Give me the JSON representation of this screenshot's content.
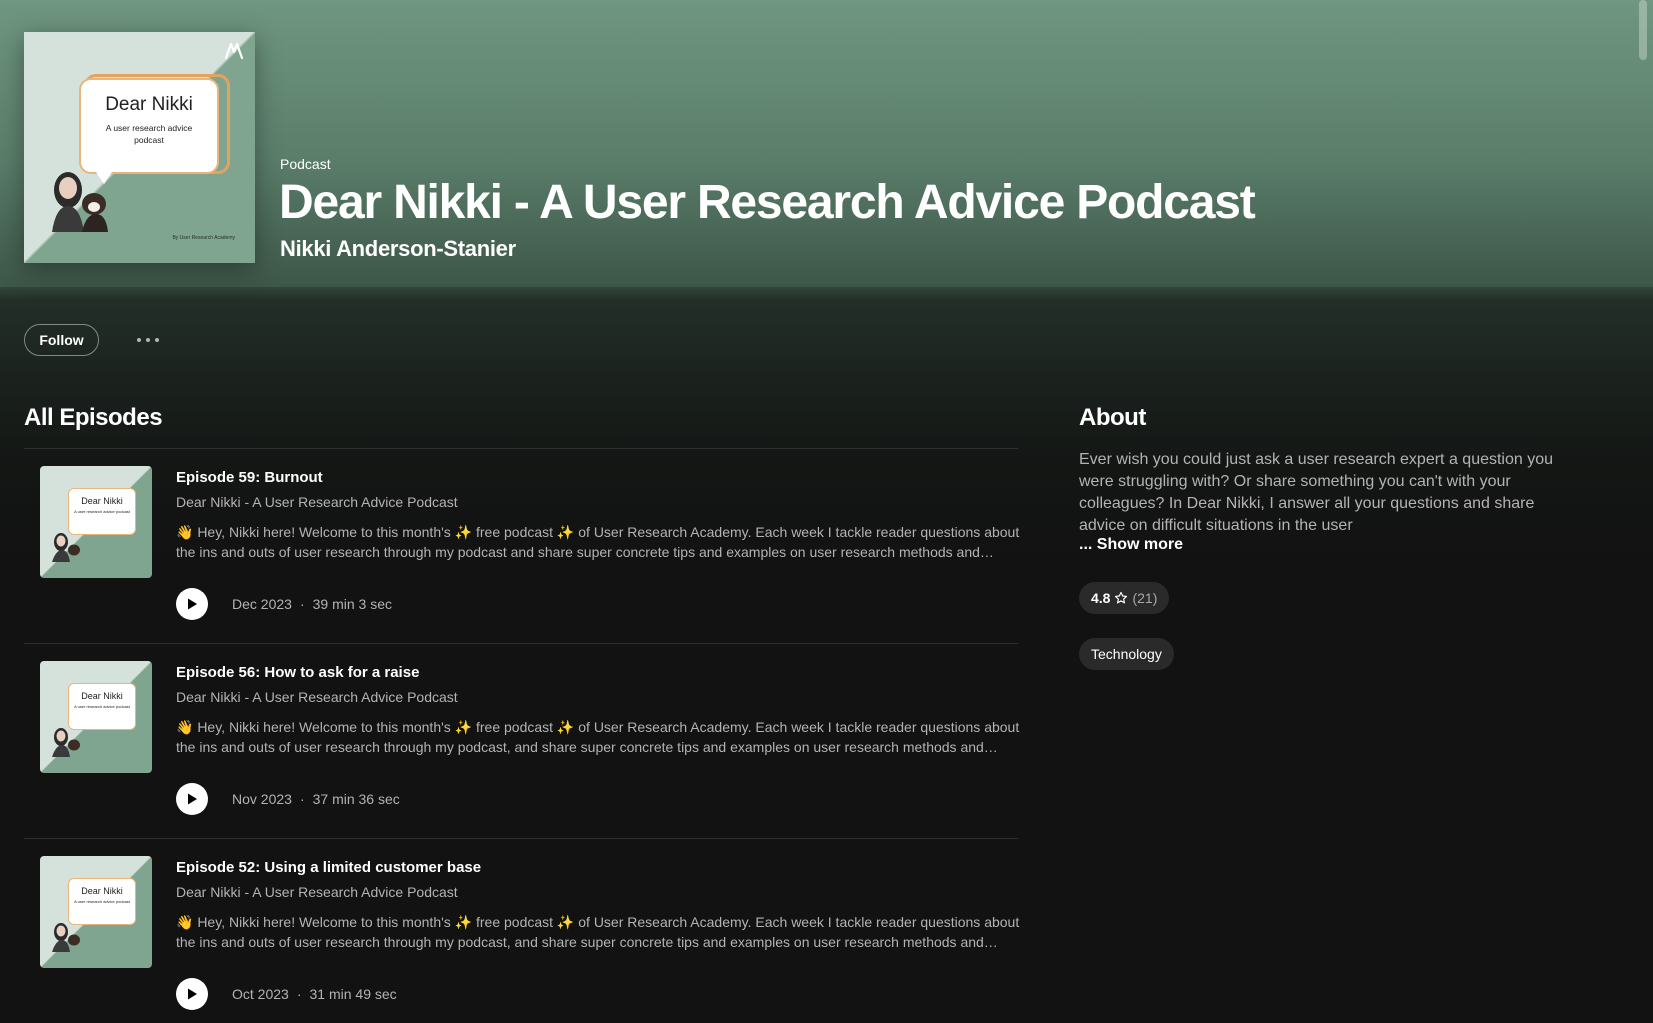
{
  "header": {
    "type_label": "Podcast",
    "title": "Dear Nikki - A User Research Advice Podcast",
    "author": "Nikki Anderson-Stanier",
    "cover": {
      "title": "Dear Nikki",
      "subtitle": "A user research advice podcast",
      "byline": "By User Research Academy"
    }
  },
  "actions": {
    "follow_label": "Follow",
    "more_icon": "more-horizontal-icon"
  },
  "episodes_section": {
    "title": "All Episodes",
    "items": [
      {
        "title": "Episode 59: Burnout",
        "show": "Dear Nikki - A User Research Advice Podcast",
        "description": "👋 Hey, Nikki here! Welcome to this month's ✨ free podcast ✨ of User Research Academy. Each week I tackle reader questions about the ins and outs of user research through my podcast and share super concrete tips and examples on user research methods and approaches.",
        "date": "Dec 2023",
        "duration": "39 min 3 sec"
      },
      {
        "title": "Episode 56: How to ask for a raise",
        "show": "Dear Nikki - A User Research Advice Podcast",
        "description": "👋 Hey, Nikki here! Welcome to this month's ✨ free podcast ✨ of User Research Academy. Each week I tackle reader questions about the ins and outs of user research through my podcast, and share super concrete tips and examples on user research methods and approaches.",
        "date": "Nov 2023",
        "duration": "37 min 36 sec"
      },
      {
        "title": "Episode 52: Using a limited customer base",
        "show": "Dear Nikki - A User Research Advice Podcast",
        "description": "👋 Hey, Nikki here! Welcome to this month's ✨ free podcast ✨ of User Research Academy. Each week I tackle reader questions about the ins and outs of user research through my podcast, and share super concrete tips and examples on user research methods and approaches.",
        "date": "Oct 2023",
        "duration": "31 min 49 sec"
      }
    ]
  },
  "about": {
    "title": "About",
    "text": "Ever wish you could just ask a user research expert a question you were struggling with? Or share something you can't with your colleagues? In Dear Nikki, I answer all your questions and share advice on difficult situations in the user",
    "show_more": "... Show more",
    "rating": "4.8",
    "rating_count": "(21)",
    "category": "Technology"
  },
  "colors": {
    "header_green": "#6f9680",
    "background": "#121212",
    "pill": "#2a2a2a",
    "muted_text": "#b3b3b3"
  }
}
